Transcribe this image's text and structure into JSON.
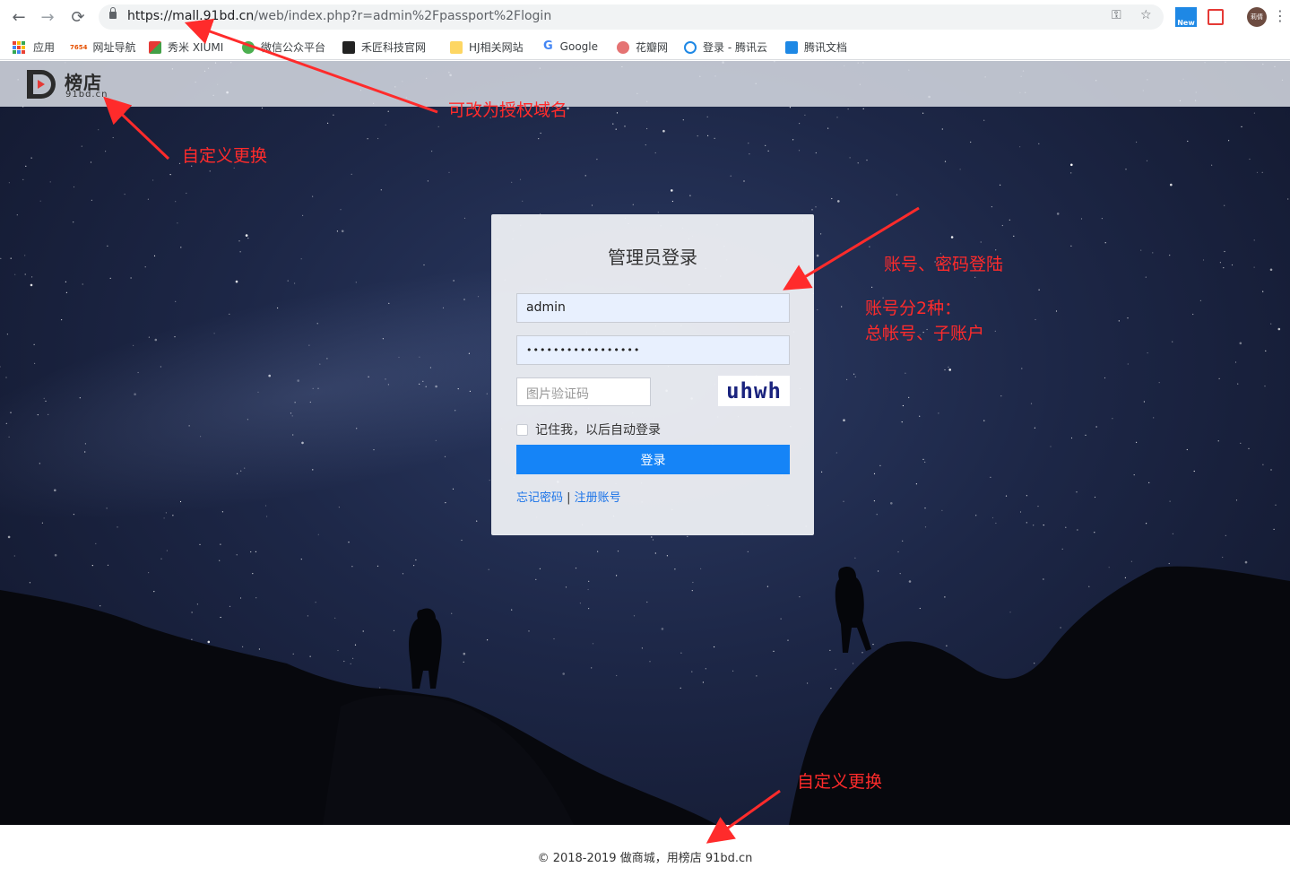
{
  "browser": {
    "url_host": "https://mall.91bd.cn",
    "url_path": "/web/index.php?r=admin%2Fpassport%2Flogin",
    "extension_new_label": "New",
    "avatar_label": "莉倩",
    "bookmarks": [
      {
        "label": "应用"
      },
      {
        "label": "网址导航",
        "badge": "7654"
      },
      {
        "label": "秀米 XIUMI"
      },
      {
        "label": "微信公众平台"
      },
      {
        "label": "禾匠科技官网"
      },
      {
        "label": "HJ相关网站"
      },
      {
        "label": "Google"
      },
      {
        "label": "花瓣网"
      },
      {
        "label": "登录 - 腾讯云"
      },
      {
        "label": "腾讯文档"
      }
    ]
  },
  "site": {
    "logo_text": "榜店",
    "logo_sub": "91bd.cn"
  },
  "login": {
    "title": "管理员登录",
    "username_value": "admin",
    "password_mask": "•••••••••••••••••",
    "captcha_placeholder": "图片验证码",
    "captcha_text": "uhwh",
    "remember_label": "记住我，以后自动登录",
    "submit_label": "登录",
    "forgot_label": "忘记密码",
    "separator": " | ",
    "register_label": "注册账号"
  },
  "footer": {
    "copyright": "© 2018-2019 做商城，用榜店 91bd.cn"
  },
  "annotations": {
    "domain_note": "可改为授权域名",
    "logo_note": "自定义更换",
    "account_note": "账号、密码登陆",
    "account_types_line1": "账号分2种：",
    "account_types_line2": "总帐号、子账户",
    "footer_note": "自定义更换"
  },
  "colors": {
    "accent": "#1584f7",
    "annotation": "#ff2b2b"
  }
}
